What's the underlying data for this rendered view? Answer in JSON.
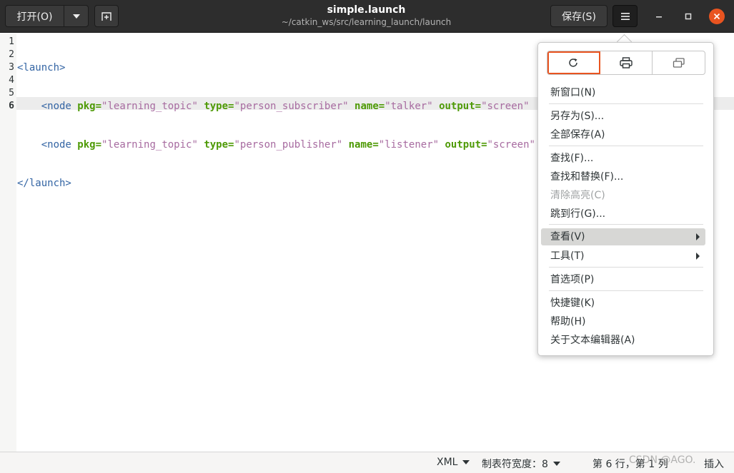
{
  "header": {
    "open_label": "打开(O)",
    "title": "simple.launch",
    "subtitle": "~/catkin_ws/src/learning_launch/launch",
    "save_label": "保存(S)"
  },
  "editor": {
    "line_numbers": [
      "1",
      "2",
      "3",
      "4",
      "5",
      "6"
    ],
    "current_line": 6
  },
  "code": {
    "l1_open": "<launch>",
    "l2_indent": "    ",
    "l2_tag": "<node",
    "l2_a1": " pkg=",
    "l2_v1": "\"learning_topic\"",
    "l2_a2": " type=",
    "l2_v2": "\"person_subscriber\"",
    "l2_a3": " name=",
    "l2_v3": "\"talker\"",
    "l2_a4": " output=",
    "l2_v4": "\"screen\"",
    "l3_indent": "    ",
    "l3_tag": "<node",
    "l3_a1": " pkg=",
    "l3_v1": "\"learning_topic\"",
    "l3_a2": " type=",
    "l3_v2": "\"person_publisher\"",
    "l3_a3": " name=",
    "l3_v3": "\"listener\"",
    "l3_a4": " output=",
    "l3_v4": "\"screen\"",
    "l4_close": "</launch>"
  },
  "menu": {
    "new_window": "新窗口(N)",
    "save_as": "另存为(S)...",
    "save_all": "全部保存(A)",
    "find": "查找(F)...",
    "find_replace": "查找和替换(F)...",
    "clear_highlight": "清除高亮(C)",
    "goto_line": "跳到行(G)...",
    "view": "查看(V)",
    "tools": "工具(T)",
    "preferences": "首选项(P)",
    "shortcuts": "快捷键(K)",
    "help": "帮助(H)",
    "about": "关于文本编辑器(A)"
  },
  "status": {
    "language": "XML",
    "tab_width": "制表符宽度：8",
    "position": "第 6 行，第 1 列",
    "insert_mode": "插入"
  },
  "watermark": "CSDN @AGO.",
  "colors": {
    "accent": "#e95420",
    "headerbar": "#2d2d2d",
    "tag": "#3465a4",
    "attribute": "#4e9a06",
    "value": "#a76ba0"
  }
}
